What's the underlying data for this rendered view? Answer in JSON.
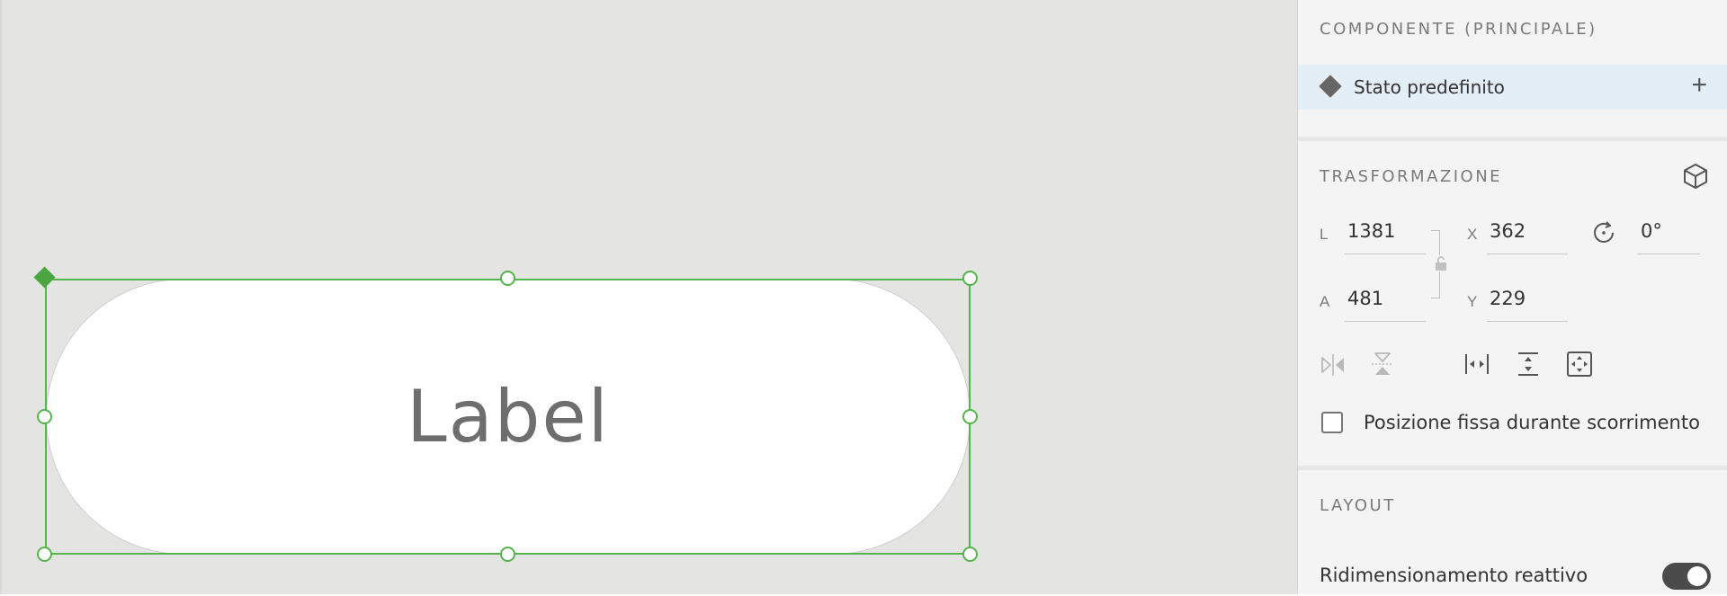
{
  "canvas": {
    "component_label": "Label"
  },
  "panel": {
    "component_section": {
      "title": "COMPONENTE (PRINCIPALE)",
      "state_label": "Stato predefinito",
      "add_label": "+"
    },
    "transform_section": {
      "title": "TRASFORMAZIONE",
      "width_label": "L",
      "width_value": "1381",
      "height_label": "A",
      "height_value": "481",
      "x_label": "X",
      "x_value": "362",
      "y_label": "Y",
      "y_value": "229",
      "rotation_value": "0°",
      "fixed_position_label": "Posizione fissa durante scorrimento"
    },
    "layout_section": {
      "title": "LAYOUT",
      "responsive_resize_label": "Ridimensionamento reattivo"
    }
  },
  "colors": {
    "selection": "#56b44e",
    "canvas_bg": "#e4e4e3",
    "panel_bg": "#f4f4f4",
    "state_row_bg": "#e3eef6"
  }
}
